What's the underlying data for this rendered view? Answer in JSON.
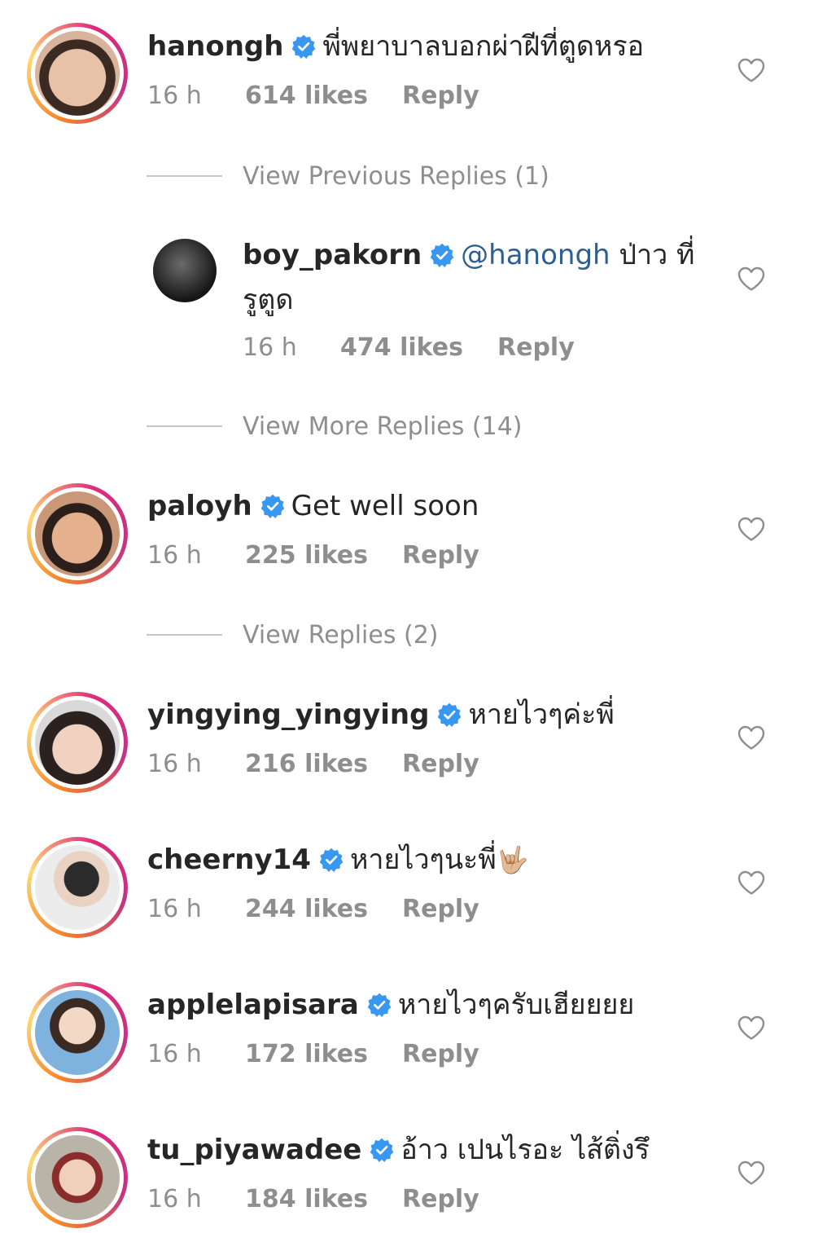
{
  "comments": [
    {
      "username": "hanongh",
      "text": "พี่พยาบาลบอกผ่าฝีที่ตูดหรอ",
      "time": "16 h",
      "likes": "614 likes",
      "reply": "Reply"
    },
    {
      "username": "boy_pakorn",
      "mention": "@hanongh",
      "text": " ป่าว ที่",
      "text_line2": "รูตูด",
      "time": "16 h",
      "likes": "474 likes",
      "reply": "Reply"
    },
    {
      "username": "paloyh",
      "text": "Get well soon",
      "time": "16 h",
      "likes": "225 likes",
      "reply": "Reply"
    },
    {
      "username": "yingying_yingying",
      "text": "หายไวๆค่ะพี่",
      "time": "16 h",
      "likes": "216 likes",
      "reply": "Reply"
    },
    {
      "username": "cheerny14",
      "text": "หายไวๆนะพี่",
      "emoji": "🤟🏼",
      "time": "16 h",
      "likes": "244 likes",
      "reply": "Reply"
    },
    {
      "username": "applelapisara",
      "text": "หายไวๆครับเฮียยยย",
      "time": "16 h",
      "likes": "172 likes",
      "reply": "Reply"
    },
    {
      "username": "tu_piyawadee",
      "text": "อ้าว เปนไรอะ ไส้ติ่งรึ",
      "time": "16 h",
      "likes": "184 likes",
      "reply": "Reply"
    }
  ],
  "view_previous_replies": "View Previous Replies (1)",
  "view_more_replies": "View More Replies (14)",
  "view_replies": "View Replies (2)",
  "icons": {
    "verified": "verified-badge-icon",
    "like": "heart-outline-icon"
  },
  "colors": {
    "verified_blue": "#3897f0",
    "meta_gray": "#8e8e8e",
    "mention_blue": "#2f5f8f"
  }
}
